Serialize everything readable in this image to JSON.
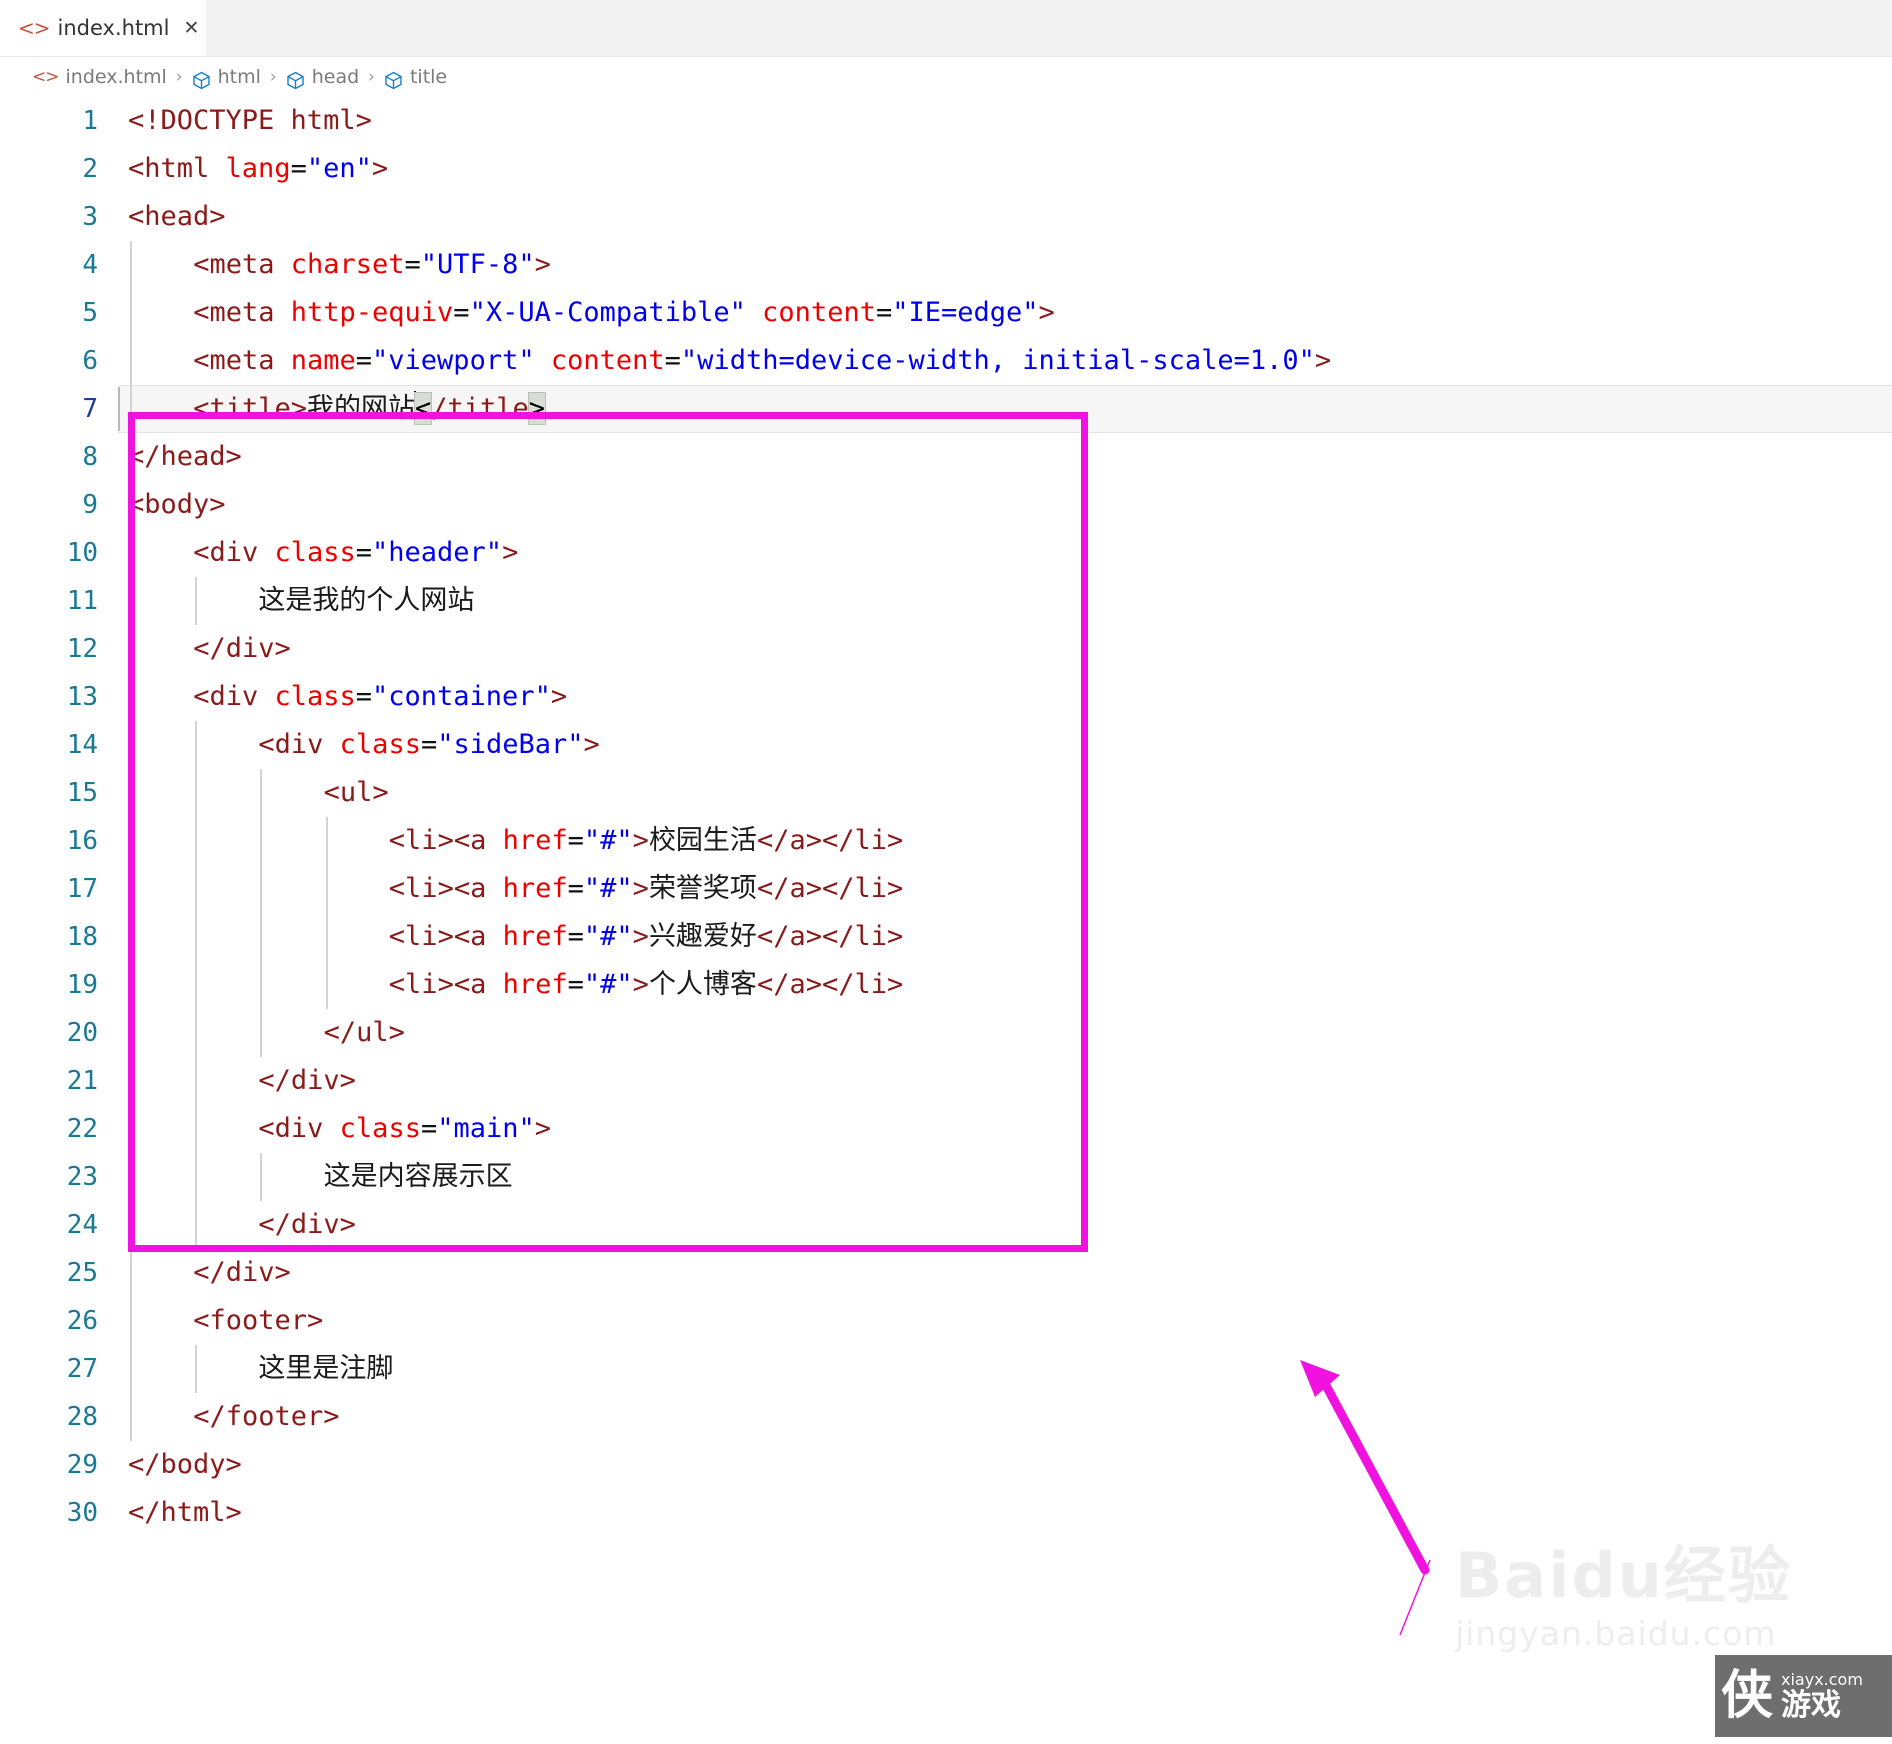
{
  "tab": {
    "icon": "code-file-icon",
    "label": "index.html",
    "close": "✕"
  },
  "breadcrumb": {
    "file_icon": "code-file-icon",
    "file": "index.html",
    "sep": "›",
    "items": [
      "html",
      "head",
      "title"
    ]
  },
  "editor": {
    "active_line": 7,
    "lines": [
      {
        "n": "1",
        "indent": 0,
        "tokens": [
          {
            "t": "tag",
            "v": "<!DOCTYPE html>"
          }
        ]
      },
      {
        "n": "2",
        "indent": 0,
        "tokens": [
          {
            "t": "tag",
            "v": "<html "
          },
          {
            "t": "attr",
            "v": "lang"
          },
          {
            "t": "eq",
            "v": "="
          },
          {
            "t": "str",
            "v": "\"en\""
          },
          {
            "t": "tag",
            "v": ">"
          }
        ]
      },
      {
        "n": "3",
        "indent": 0,
        "tokens": [
          {
            "t": "tag",
            "v": "<head>"
          }
        ]
      },
      {
        "n": "4",
        "indent": 1,
        "tokens": [
          {
            "t": "tag",
            "v": "<meta "
          },
          {
            "t": "attr",
            "v": "charset"
          },
          {
            "t": "eq",
            "v": "="
          },
          {
            "t": "str",
            "v": "\"UTF-8\""
          },
          {
            "t": "tag",
            "v": ">"
          }
        ]
      },
      {
        "n": "5",
        "indent": 1,
        "tokens": [
          {
            "t": "tag",
            "v": "<meta "
          },
          {
            "t": "attr",
            "v": "http-equiv"
          },
          {
            "t": "eq",
            "v": "="
          },
          {
            "t": "str",
            "v": "\"X-UA-Compatible\""
          },
          {
            "t": "plain",
            "v": " "
          },
          {
            "t": "attr",
            "v": "content"
          },
          {
            "t": "eq",
            "v": "="
          },
          {
            "t": "str",
            "v": "\"IE=edge\""
          },
          {
            "t": "tag",
            "v": ">"
          }
        ]
      },
      {
        "n": "6",
        "indent": 1,
        "tokens": [
          {
            "t": "tag",
            "v": "<meta "
          },
          {
            "t": "attr",
            "v": "name"
          },
          {
            "t": "eq",
            "v": "="
          },
          {
            "t": "str",
            "v": "\"viewport\""
          },
          {
            "t": "plain",
            "v": " "
          },
          {
            "t": "attr",
            "v": "content"
          },
          {
            "t": "eq",
            "v": "="
          },
          {
            "t": "str",
            "v": "\"width=device-width, initial-scale=1.0\""
          },
          {
            "t": "tag",
            "v": ">"
          }
        ]
      },
      {
        "n": "7",
        "indent": 1,
        "tokens": [
          {
            "t": "tag",
            "v": "<title>"
          },
          {
            "t": "txt",
            "v": "我的网站"
          },
          {
            "t": "caret",
            "v": ""
          },
          {
            "t": "brk",
            "v": "<"
          },
          {
            "t": "tag",
            "v": "/title"
          },
          {
            "t": "brk",
            "v": ">"
          }
        ]
      },
      {
        "n": "8",
        "indent": 0,
        "tokens": [
          {
            "t": "tag",
            "v": "</head>"
          }
        ]
      },
      {
        "n": "9",
        "indent": 0,
        "tokens": [
          {
            "t": "tag",
            "v": "<body>"
          }
        ]
      },
      {
        "n": "10",
        "indent": 1,
        "tokens": [
          {
            "t": "tag",
            "v": "<div "
          },
          {
            "t": "attr",
            "v": "class"
          },
          {
            "t": "eq",
            "v": "="
          },
          {
            "t": "str",
            "v": "\"header\""
          },
          {
            "t": "tag",
            "v": ">"
          }
        ]
      },
      {
        "n": "11",
        "indent": 2,
        "tokens": [
          {
            "t": "txt",
            "v": "这是我的个人网站"
          }
        ]
      },
      {
        "n": "12",
        "indent": 1,
        "tokens": [
          {
            "t": "tag",
            "v": "</div>"
          }
        ]
      },
      {
        "n": "13",
        "indent": 1,
        "tokens": [
          {
            "t": "tag",
            "v": "<div "
          },
          {
            "t": "attr",
            "v": "class"
          },
          {
            "t": "eq",
            "v": "="
          },
          {
            "t": "str",
            "v": "\"container\""
          },
          {
            "t": "tag",
            "v": ">"
          }
        ]
      },
      {
        "n": "14",
        "indent": 2,
        "tokens": [
          {
            "t": "tag",
            "v": "<div "
          },
          {
            "t": "attr",
            "v": "class"
          },
          {
            "t": "eq",
            "v": "="
          },
          {
            "t": "str",
            "v": "\"sideBar\""
          },
          {
            "t": "tag",
            "v": ">"
          }
        ]
      },
      {
        "n": "15",
        "indent": 3,
        "tokens": [
          {
            "t": "tag",
            "v": "<ul>"
          }
        ]
      },
      {
        "n": "16",
        "indent": 4,
        "tokens": [
          {
            "t": "tag",
            "v": "<li><a "
          },
          {
            "t": "attr",
            "v": "href"
          },
          {
            "t": "eq",
            "v": "="
          },
          {
            "t": "str",
            "v": "\"#\""
          },
          {
            "t": "tag",
            "v": ">"
          },
          {
            "t": "txt",
            "v": "校园生活"
          },
          {
            "t": "tag",
            "v": "</a></li>"
          }
        ]
      },
      {
        "n": "17",
        "indent": 4,
        "tokens": [
          {
            "t": "tag",
            "v": "<li><a "
          },
          {
            "t": "attr",
            "v": "href"
          },
          {
            "t": "eq",
            "v": "="
          },
          {
            "t": "str",
            "v": "\"#\""
          },
          {
            "t": "tag",
            "v": ">"
          },
          {
            "t": "txt",
            "v": "荣誉奖项"
          },
          {
            "t": "tag",
            "v": "</a></li>"
          }
        ]
      },
      {
        "n": "18",
        "indent": 4,
        "tokens": [
          {
            "t": "tag",
            "v": "<li><a "
          },
          {
            "t": "attr",
            "v": "href"
          },
          {
            "t": "eq",
            "v": "="
          },
          {
            "t": "str",
            "v": "\"#\""
          },
          {
            "t": "tag",
            "v": ">"
          },
          {
            "t": "txt",
            "v": "兴趣爱好"
          },
          {
            "t": "tag",
            "v": "</a></li>"
          }
        ]
      },
      {
        "n": "19",
        "indent": 4,
        "tokens": [
          {
            "t": "tag",
            "v": "<li><a "
          },
          {
            "t": "attr",
            "v": "href"
          },
          {
            "t": "eq",
            "v": "="
          },
          {
            "t": "str",
            "v": "\"#\""
          },
          {
            "t": "tag",
            "v": ">"
          },
          {
            "t": "txt",
            "v": "个人博客"
          },
          {
            "t": "tag",
            "v": "</a></li>"
          }
        ]
      },
      {
        "n": "20",
        "indent": 3,
        "tokens": [
          {
            "t": "tag",
            "v": "</ul>"
          }
        ]
      },
      {
        "n": "21",
        "indent": 2,
        "tokens": [
          {
            "t": "tag",
            "v": "</div>"
          }
        ]
      },
      {
        "n": "22",
        "indent": 2,
        "tokens": [
          {
            "t": "tag",
            "v": "<div "
          },
          {
            "t": "attr",
            "v": "class"
          },
          {
            "t": "eq",
            "v": "="
          },
          {
            "t": "str",
            "v": "\"main\""
          },
          {
            "t": "tag",
            "v": ">"
          }
        ]
      },
      {
        "n": "23",
        "indent": 3,
        "tokens": [
          {
            "t": "txt",
            "v": "这是内容展示区"
          }
        ]
      },
      {
        "n": "24",
        "indent": 2,
        "tokens": [
          {
            "t": "tag",
            "v": "</div>"
          }
        ]
      },
      {
        "n": "25",
        "indent": 1,
        "tokens": [
          {
            "t": "tag",
            "v": "</div>"
          }
        ]
      },
      {
        "n": "26",
        "indent": 1,
        "tokens": [
          {
            "t": "tag",
            "v": "<footer>"
          }
        ]
      },
      {
        "n": "27",
        "indent": 2,
        "tokens": [
          {
            "t": "txt",
            "v": "这里是注脚"
          }
        ]
      },
      {
        "n": "28",
        "indent": 1,
        "tokens": [
          {
            "t": "tag",
            "v": "</footer>"
          }
        ]
      },
      {
        "n": "29",
        "indent": 0,
        "tokens": [
          {
            "t": "tag",
            "v": "</body>"
          }
        ]
      },
      {
        "n": "30",
        "indent": 0,
        "tokens": [
          {
            "t": "tag",
            "v": "</html>"
          }
        ]
      }
    ]
  },
  "annotation": {
    "box_color": "#f013e0",
    "arrow_color": "#f013e0"
  },
  "watermark": {
    "baidu_line1": "Baidu经验",
    "baidu_line2": "jingyan.baidu.com",
    "logo_glyph": "侠",
    "logo_domain": "xiayx.com",
    "logo_word": "游戏"
  },
  "colors": {
    "tag": "#8b1a1a",
    "attribute": "#ee0000",
    "string": "#0000ee",
    "lineno": "#1a7a96",
    "lineno_active": "#1f3f8f",
    "magenta": "#f013e0",
    "tabbar_bg": "#f3f3f3"
  }
}
